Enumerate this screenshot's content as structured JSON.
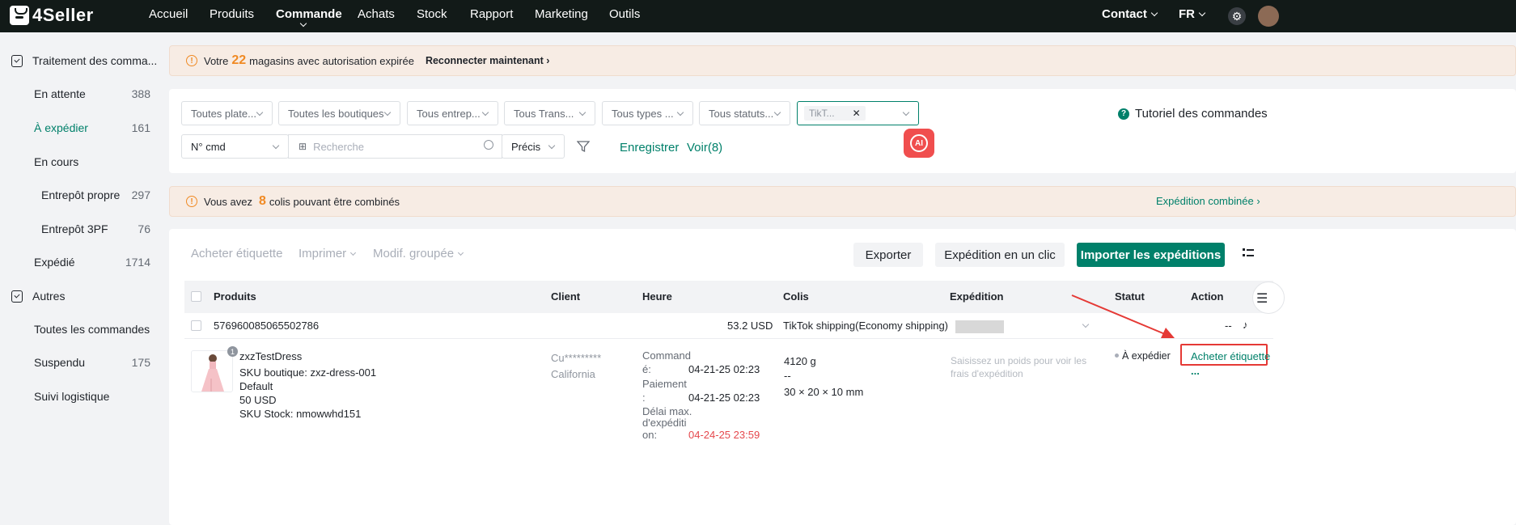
{
  "app": {
    "logo": "4Seller"
  },
  "nav": {
    "items": [
      "Accueil",
      "Produits",
      "Commande",
      "Achats",
      "Stock",
      "Rapport",
      "Marketing",
      "Outils"
    ],
    "contact": "Contact",
    "language": "FR"
  },
  "sidebar": {
    "group1": "Traitement des comma...",
    "items": [
      {
        "label": "En attente",
        "count": "388"
      },
      {
        "label": "À expédier",
        "count": "161"
      },
      {
        "label": "En cours",
        "count": ""
      },
      {
        "label": "Entrepôt propre",
        "count": "297"
      },
      {
        "label": "Entrepôt 3PF",
        "count": "76"
      },
      {
        "label": "Expédié",
        "count": "1714"
      }
    ],
    "group2": "Autres",
    "items2": [
      {
        "label": "Toutes les commandes",
        "count": ""
      },
      {
        "label": "Suspendu",
        "count": "175"
      },
      {
        "label": "Suivi logistique",
        "count": ""
      }
    ]
  },
  "banner1": {
    "prefix": "Votre",
    "number": "22",
    "text": "magasins avec autorisation expirée",
    "action": "Reconnecter maintenant"
  },
  "filters": {
    "platform": "Toutes plate...",
    "shops": "Toutes les boutiques",
    "warehouse": "Tous entrep...",
    "transport": "Tous Trans...",
    "types": "Tous types ...",
    "status": "Tous statuts...",
    "tag": "TikT...",
    "order_field": "N° cmd",
    "search_placeholder": "Recherche",
    "match": "Précis",
    "save": "Enregistrer",
    "view": "Voir(8)",
    "tutorial": "Tutoriel des commandes",
    "ai": "AI"
  },
  "banner2": {
    "prefix": "Vous avez",
    "number": "8",
    "text": "colis pouvant être combinés",
    "action": "Expédition combinée"
  },
  "toolbar": {
    "buy_label": "Acheter étiquette",
    "print": "Imprimer",
    "bulk_edit": "Modif. groupée",
    "export": "Exporter",
    "one_click": "Expédition en un clic",
    "import": "Importer les expéditions"
  },
  "table": {
    "headers": [
      "Produits",
      "Client",
      "Heure",
      "Colis",
      "Expédition",
      "Statut",
      "Action"
    ],
    "order": {
      "id": "576960085065502786",
      "amount": "53.2 USD",
      "shipping": "TikTok shipping(Economy shipping)",
      "dash": "--"
    },
    "item": {
      "badge": "1",
      "name": "zxzTestDress",
      "sku": "SKU boutique: zxz-dress-001",
      "variant": "Default",
      "price": "50 USD",
      "stock_sku": "SKU Stock: nmowwhd151",
      "client_name": "Cu*********",
      "client_region": "California",
      "ordered_label_1": "Command",
      "ordered_label_2": "é:",
      "ordered_time": "04-21-25 02:23",
      "paid_label_1": "Paiement",
      "paid_label_2": ":",
      "paid_time": "04-21-25 02:23",
      "deadline_label_1": "Délai max.",
      "deadline_label_2": "d'expéditi",
      "deadline_label_3": "on:",
      "deadline_time": "04-24-25 23:59",
      "weight": "4120 g",
      "dash": "--",
      "dimensions": "30 × 20 × 10 mm",
      "shipping_hint_1": "Saisissez un poids pour voir les",
      "shipping_hint_2": "frais d'expédition",
      "status": "À expédier",
      "action": "Acheter étiquette",
      "more": "..."
    }
  },
  "colors": {
    "brand": "#00806a",
    "warning": "#f08a24",
    "danger": "#e5484d",
    "nav_bg": "#121a18"
  }
}
